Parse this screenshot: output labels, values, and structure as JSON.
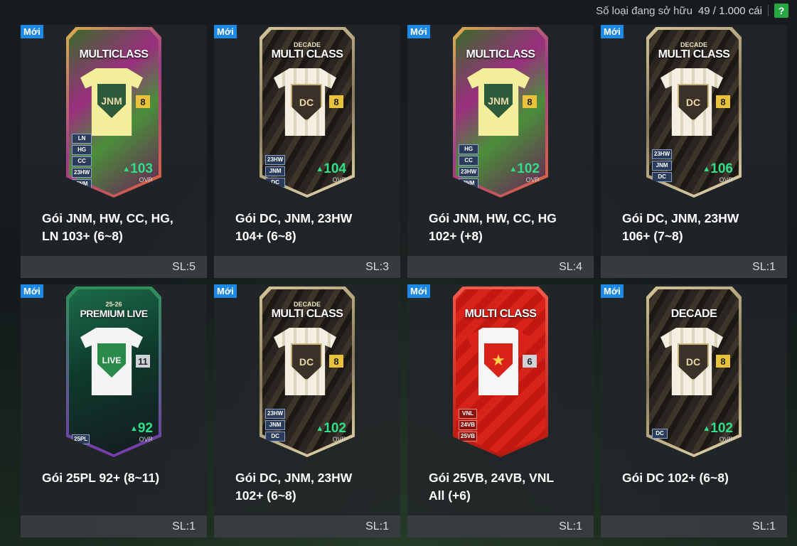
{
  "header": {
    "owned_label": "Số loại đang sở hữu",
    "owned_count": "49 / 1.000 cái",
    "help": "?"
  },
  "colors": {
    "new_badge": "#1e88e5",
    "ovr_green": "#2ee08a",
    "help_green": "#28a745"
  },
  "packs": [
    {
      "new": "Mới",
      "card_title": "MULTICLASS",
      "card_subtitle": "",
      "level": "8",
      "tags": [
        "LN",
        "HG",
        "CC",
        "23HW",
        "JNM"
      ],
      "ovr": "103",
      "ovr_label": "OVR",
      "name": "Gói JNM, HW, CC, HG, LN 103+ (6~8)",
      "qty": "SL:5"
    },
    {
      "new": "Mới",
      "card_title": "MULTI CLASS",
      "card_subtitle": "DECADE",
      "level": "8",
      "tags": [
        "23HW",
        "JNM",
        "DC"
      ],
      "ovr": "104",
      "ovr_label": "OVR",
      "name": "Gói DC, JNM, 23HW 104+ (6~8)",
      "qty": "SL:3"
    },
    {
      "new": "Mới",
      "card_title": "MULTICLASS",
      "card_subtitle": "",
      "level": "8",
      "tags": [
        "HG",
        "CC",
        "23HW",
        "JNM"
      ],
      "ovr": "102",
      "ovr_label": "OVR",
      "name": "Gói JNM, HW, CC, HG 102+ (+8)",
      "qty": "SL:4"
    },
    {
      "new": "Mới",
      "card_title": "MULTI CLASS",
      "card_subtitle": "DECADE",
      "level": "8",
      "tags": [
        "23HW",
        "JNM",
        "DC"
      ],
      "ovr": "106",
      "ovr_label": "OVR",
      "name": "Gói DC, JNM, 23HW 106+ (7~8)",
      "qty": "SL:1"
    },
    {
      "new": "Mới",
      "card_title": "PREMIUM LIVE",
      "card_subtitle": "25-26",
      "level": "11",
      "tags": [
        "25PL"
      ],
      "ovr": "92",
      "ovr_label": "OVR",
      "name": "Gói 25PL 92+ (8~11)",
      "qty": "SL:1"
    },
    {
      "new": "Mới",
      "card_title": "MULTI CLASS",
      "card_subtitle": "DECADE",
      "level": "8",
      "tags": [
        "23HW",
        "JNM",
        "DC"
      ],
      "ovr": "102",
      "ovr_label": "OVR",
      "name": "Gói DC, JNM, 23HW 102+ (6~8)",
      "qty": "SL:1"
    },
    {
      "new": "Mới",
      "card_title": "MULTI CLASS",
      "card_subtitle": "",
      "level": "6",
      "tags": [
        "VNL",
        "24VB",
        "25VB"
      ],
      "ovr": "",
      "ovr_label": "",
      "name": "Gói 25VB, 24VB, VNL All (+6)",
      "qty": "SL:1"
    },
    {
      "new": "Mới",
      "card_title": "DECADE",
      "card_subtitle": "",
      "level": "8",
      "tags": [
        "DC"
      ],
      "ovr": "102",
      "ovr_label": "OVR",
      "name": "Gói DC 102+ (6~8)",
      "qty": "SL:1"
    }
  ]
}
